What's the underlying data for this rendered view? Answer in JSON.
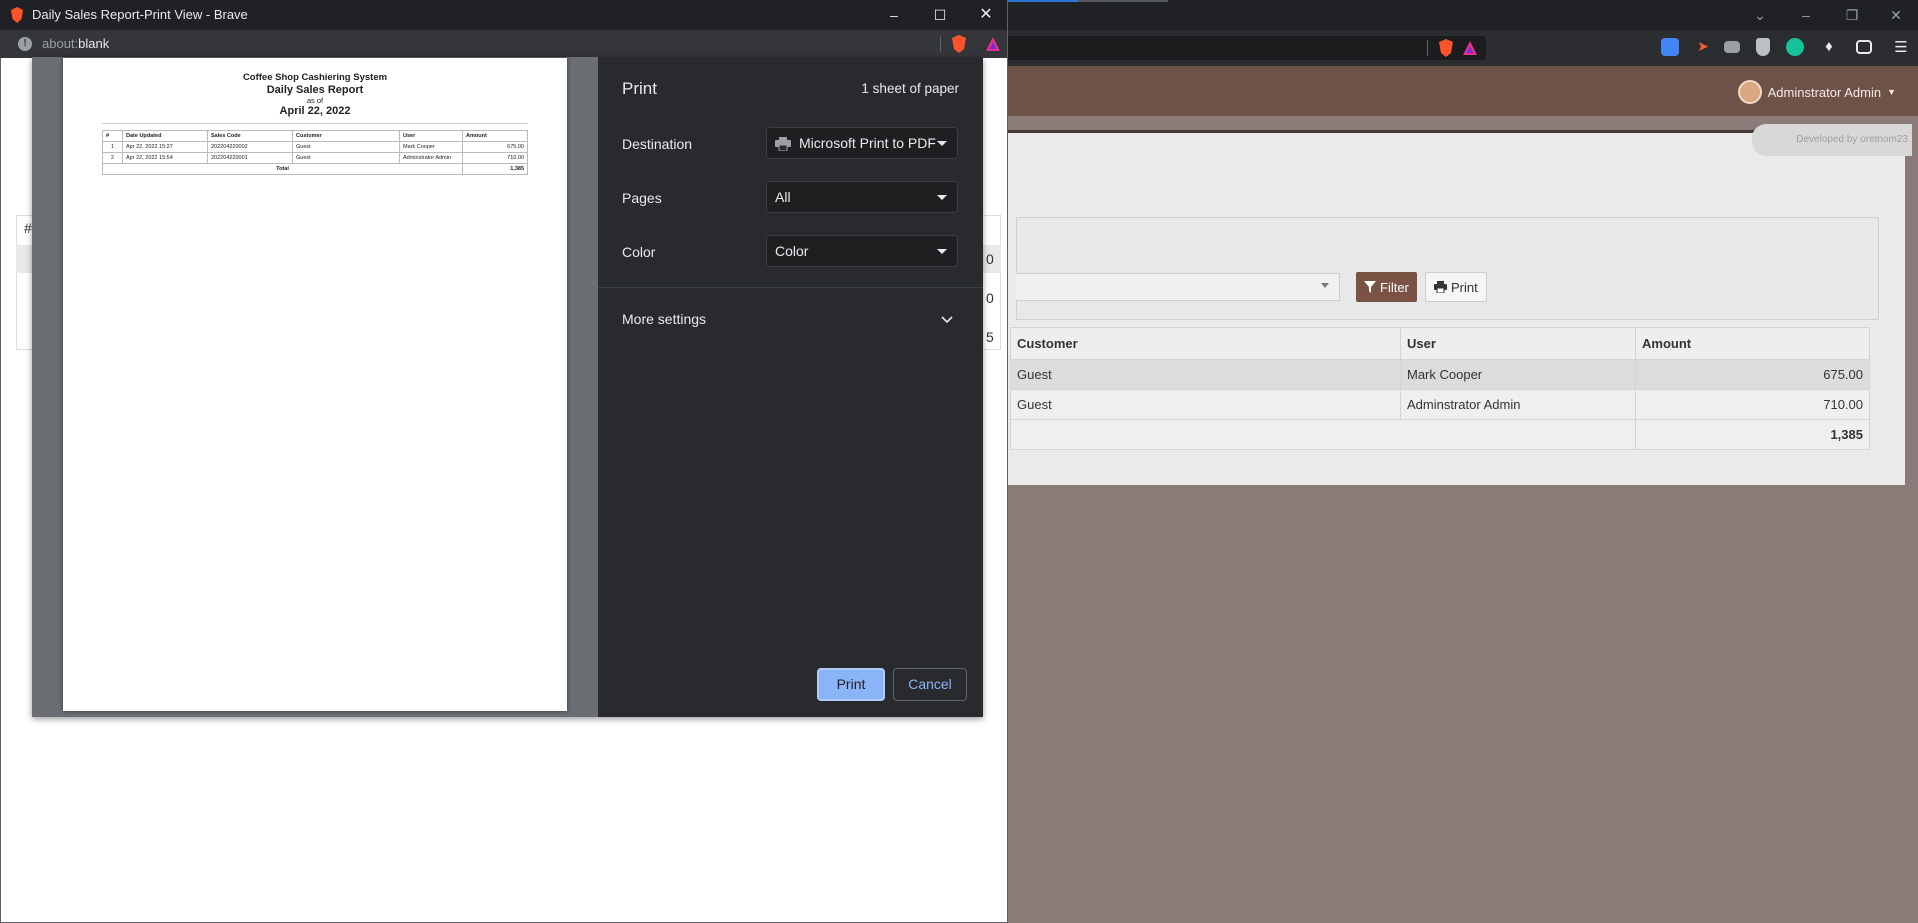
{
  "background_app": {
    "user_menu_label": "Adminstrator Admin",
    "developer_badge": "Developed by oretnom23",
    "filter_button": "Filter",
    "print_button": "Print",
    "table": {
      "headers": [
        "Customer",
        "User",
        "Amount"
      ],
      "rows": [
        {
          "customer": "Guest",
          "user": "Mark Cooper",
          "amount": "675.00"
        },
        {
          "customer": "Guest",
          "user": "Adminstrator Admin",
          "amount": "710.00"
        }
      ],
      "total": "1,385"
    },
    "ghost_left": {
      "hash": "#",
      "row1": "0",
      "row2": "0",
      "row3": "5"
    }
  },
  "popup": {
    "window_title": "Daily Sales Report-Print View - Brave",
    "address_scheme": "about:",
    "address_path": "blank"
  },
  "print_dialog": {
    "title": "Print",
    "sheet_count": "1 sheet of paper",
    "destination_label": "Destination",
    "destination_value": "Microsoft Print to PDF",
    "pages_label": "Pages",
    "pages_value": "All",
    "color_label": "Color",
    "color_value": "Color",
    "more_settings": "More settings",
    "print_button": "Print",
    "cancel_button": "Cancel"
  },
  "report_preview": {
    "system_name": "Coffee Shop Cashiering System",
    "report_title": "Daily Sales Report",
    "as_of": "as of",
    "date": "April 22, 2022",
    "headers": [
      "#",
      "Date Updated",
      "Sales Code",
      "Customer",
      "User",
      "Amount"
    ],
    "rows": [
      {
        "n": "1",
        "date": "Apr 22, 2022 15:27",
        "code": "202204220002",
        "customer": "Guest",
        "user": "Mark Cooper",
        "amount": "675.00"
      },
      {
        "n": "2",
        "date": "Apr 22, 2022 15:54",
        "code": "202204220001",
        "customer": "Guest",
        "user": "Adminstrator Admin",
        "amount": "710.00"
      }
    ],
    "total_label": "Total",
    "total_value": "1,385"
  }
}
